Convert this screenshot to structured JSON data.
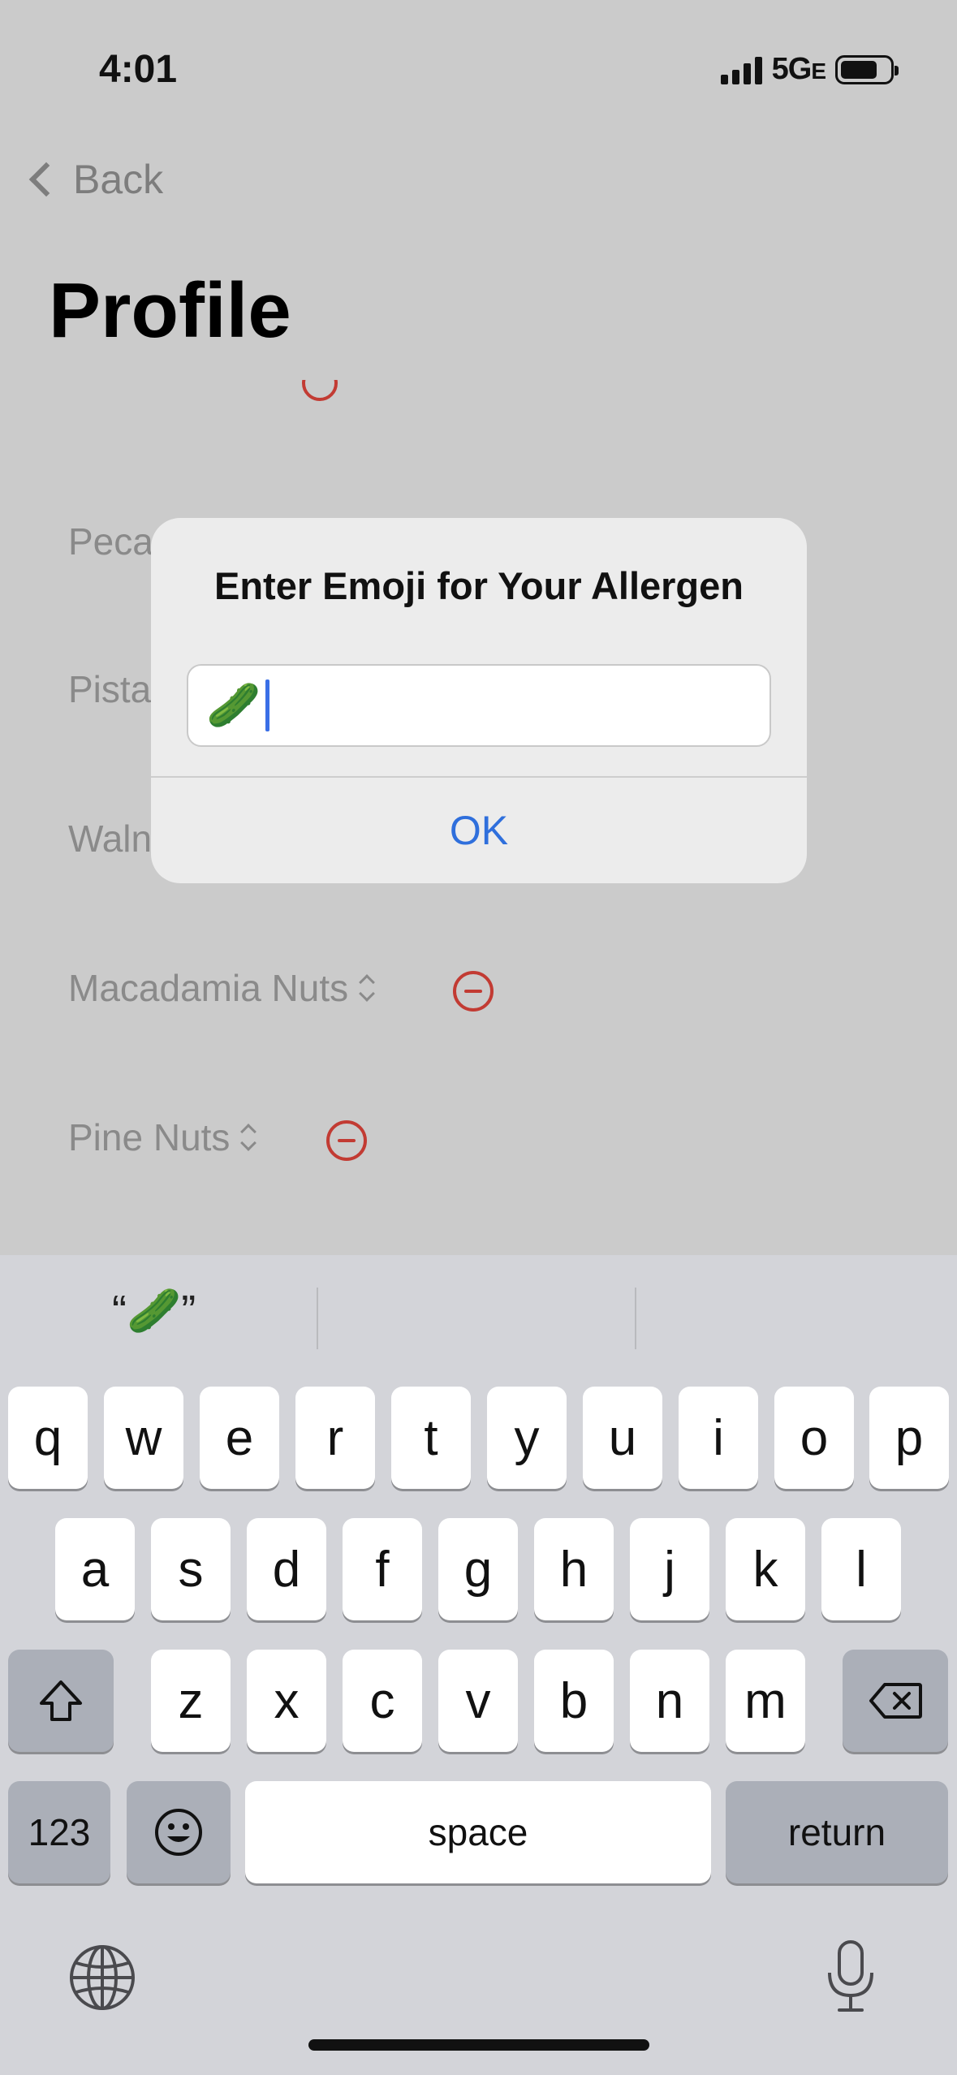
{
  "status_bar": {
    "time": "4:01",
    "network": "5G",
    "network_suffix": "E"
  },
  "nav": {
    "back_label": "Back"
  },
  "page": {
    "title": "Profile"
  },
  "allergen_rows": [
    {
      "name": "Peca"
    },
    {
      "name": "Pista"
    },
    {
      "name": "Waln"
    },
    {
      "name": "Macadamia Nuts"
    },
    {
      "name": "Pine Nuts"
    }
  ],
  "alert": {
    "title": "Enter Emoji for Your Allergen",
    "input_value": "🥒",
    "ok_label": "OK"
  },
  "keyboard": {
    "prediction": "“🥒”",
    "row1": [
      "q",
      "w",
      "e",
      "r",
      "t",
      "y",
      "u",
      "i",
      "o",
      "p"
    ],
    "row2": [
      "a",
      "s",
      "d",
      "f",
      "g",
      "h",
      "j",
      "k",
      "l"
    ],
    "row3": [
      "z",
      "x",
      "c",
      "v",
      "b",
      "n",
      "m"
    ],
    "numbers_label": "123",
    "space_label": "space",
    "return_label": "return"
  },
  "colors": {
    "accent": "#2f6fdc",
    "destructive": "#c23b33",
    "caret": "#3a6fe6"
  }
}
